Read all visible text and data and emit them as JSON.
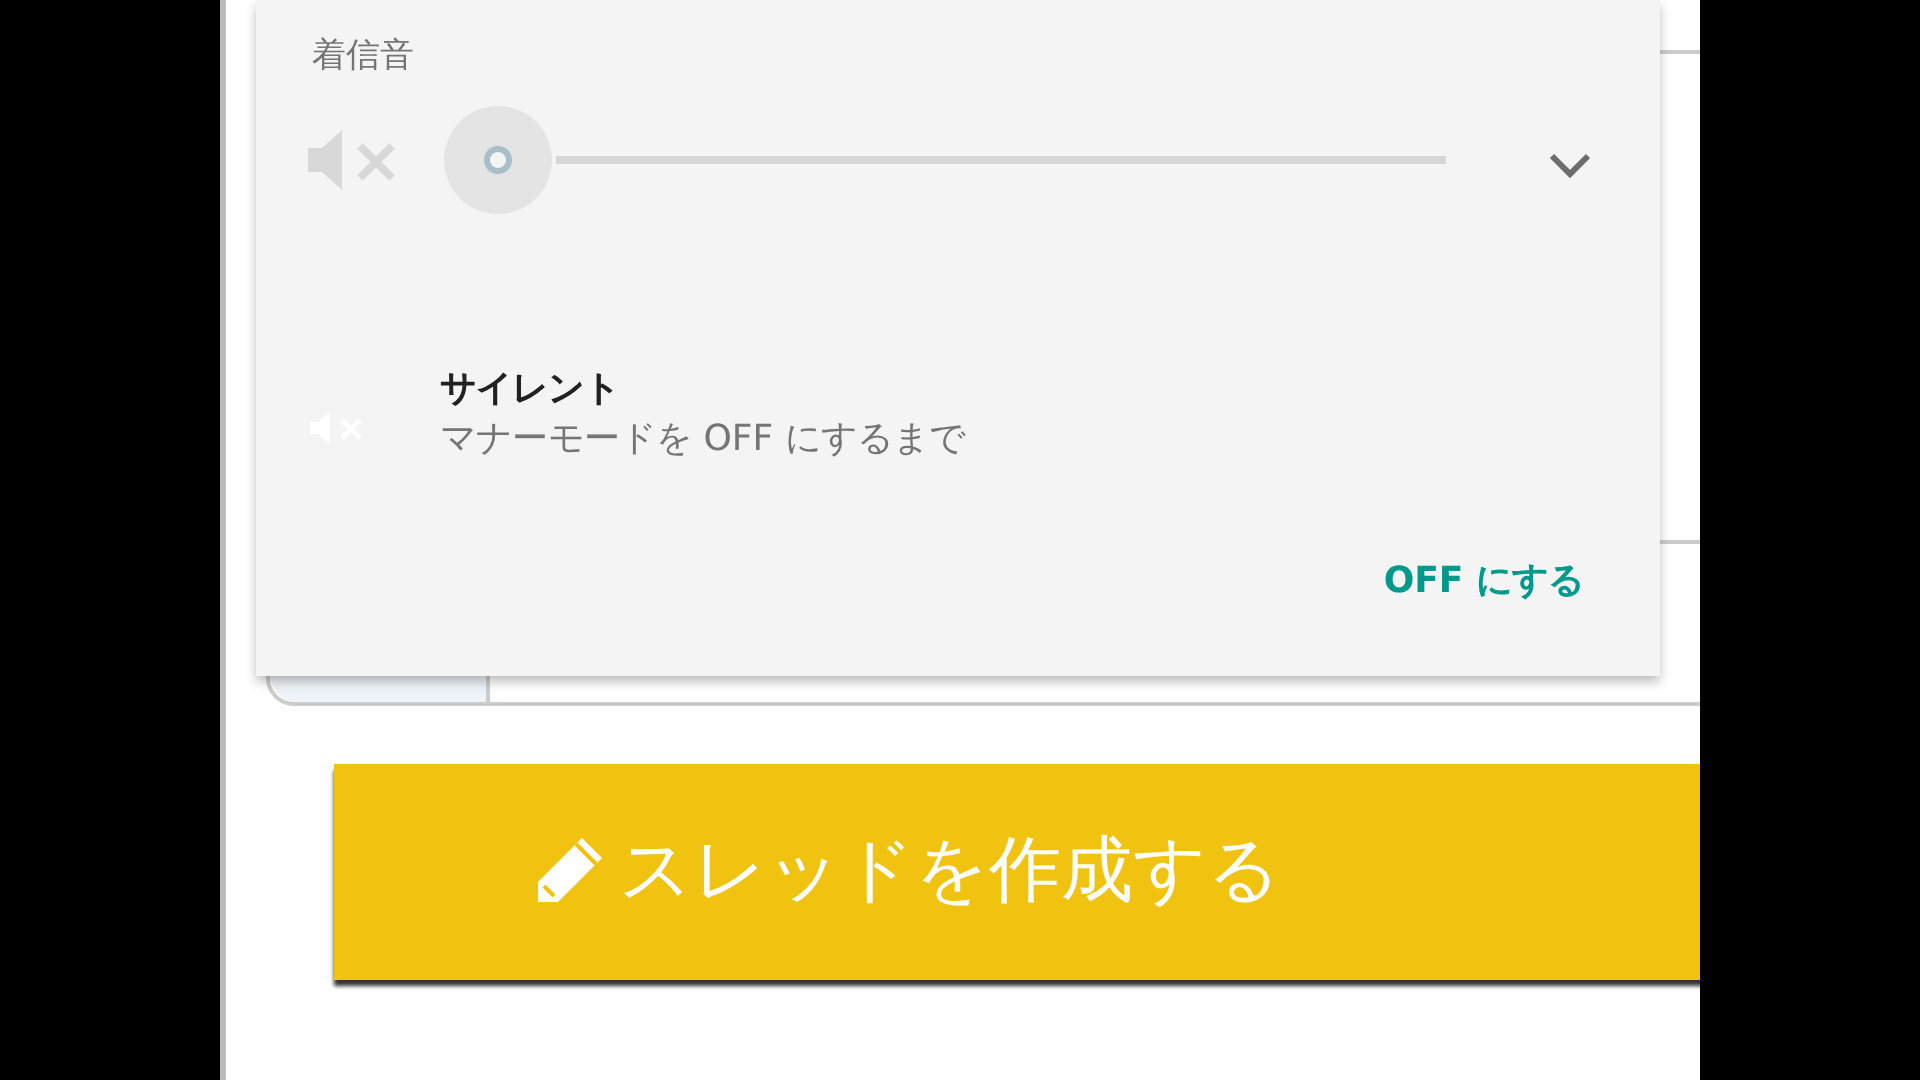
{
  "ringtone": {
    "label": "着信音",
    "muted": true,
    "expanded": false
  },
  "silent_mode": {
    "title": "サイレント",
    "subtitle": "マナーモードを OFF にするまで",
    "action": "OFF にする"
  },
  "create_thread_button": {
    "label": "スレッドを作成する"
  }
}
